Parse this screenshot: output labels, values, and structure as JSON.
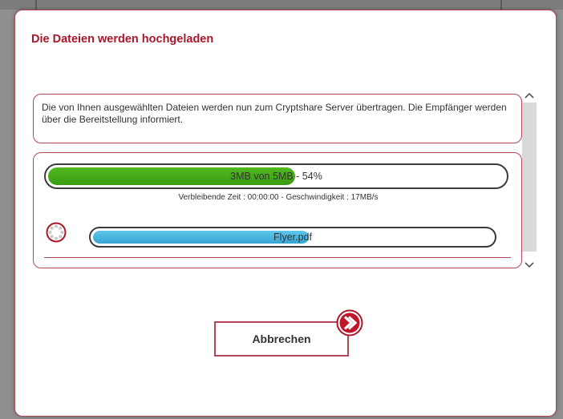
{
  "dialog": {
    "title": "Die Dateien werden hochgeladen",
    "info_text": "Die von Ihnen ausgewählten Dateien werden nun zum Cryptshare Server übertragen. Die Empfänger werden über die Bereitstellung informiert."
  },
  "upload": {
    "total_label": "3MB von  5MB - 54%",
    "total_progress_percent": 54,
    "remaining_label": "Verbleibende Zeit : 00:00:00 -  Geschwindigkeit : 17MB/s",
    "file_name": "Flyer.pdf",
    "file_progress_percent": 54
  },
  "actions": {
    "cancel_label": "Abbrechen"
  },
  "colors": {
    "accent": "#a8182b",
    "border": "#b24756",
    "progress_green": "#4aab1b",
    "progress_blue": "#3fb3de"
  },
  "icons": {
    "spinner": "loading-spinner-icon",
    "scroll_up": "chevron-up-icon",
    "scroll_down": "chevron-down-icon",
    "cancel_badge": "chevron-right-icon"
  }
}
